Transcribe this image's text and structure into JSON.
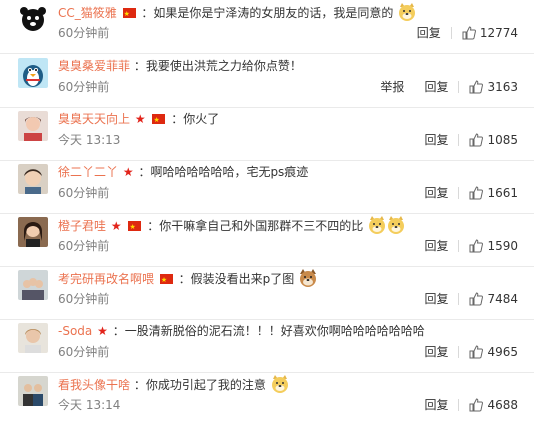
{
  "comments": [
    {
      "name": "CC_猫筱雅",
      "badges": "flag",
      "text": "：如果是你是宁泽涛的女朋友的话，我是同意的",
      "emoji": 1,
      "time": "60分钟前",
      "report": "",
      "reply": "回复",
      "likes": "12774",
      "avatar": "bear-avatar"
    },
    {
      "name": "臭臭桑爱菲菲",
      "badges": "",
      "text": "：我要使出洪荒之力给你点赞！",
      "emoji": 0,
      "time": "60分钟前",
      "report": "举报",
      "reply": "回复",
      "likes": "3163",
      "avatar": "penguin-avatar"
    },
    {
      "name": "臭臭天天向上",
      "badges": "star-flag",
      "text": "：你火了",
      "emoji": 0,
      "time": "今天 13:13",
      "report": "",
      "reply": "回复",
      "likes": "1085",
      "avatar": "girl-avatar"
    },
    {
      "name": "徐二丫二丫",
      "badges": "star",
      "text": "：啊哈哈哈哈哈哈，宅无ps痕迹",
      "emoji": 0,
      "time": "60分钟前",
      "report": "",
      "reply": "回复",
      "likes": "1661",
      "avatar": "child-avatar"
    },
    {
      "name": "橙子君哇",
      "badges": "star-flag",
      "text": "：你干嘛拿自己和外国那群不三不四的比",
      "emoji": 2,
      "time": "60分钟前",
      "report": "",
      "reply": "回复",
      "likes": "1590",
      "avatar": "woman-avatar"
    },
    {
      "name": "考完研再改名啊喂",
      "badges": "flag",
      "text": "：假装没看出来p了图",
      "emoji": 1,
      "time": "60分钟前",
      "report": "",
      "reply": "回复",
      "likes": "7484",
      "avatar": "group-avatar"
    },
    {
      "name": "-Soda",
      "badges": "star",
      "text": "：一股清新脱俗的泥石流！！！好喜欢你啊哈哈哈哈哈哈哈",
      "emoji": 0,
      "time": "60分钟前",
      "report": "",
      "reply": "回复",
      "likes": "4965",
      "avatar": "person-avatar"
    },
    {
      "name": "看我头像干啥",
      "badges": "",
      "text": "：你成功引起了我的注意",
      "emoji": 1,
      "time": "今天 13:14",
      "report": "",
      "reply": "回复",
      "likes": "4688",
      "avatar": "couple-avatar"
    }
  ],
  "colors": {
    "name": "#eb7350",
    "text": "#333333",
    "muted": "#808080"
  }
}
